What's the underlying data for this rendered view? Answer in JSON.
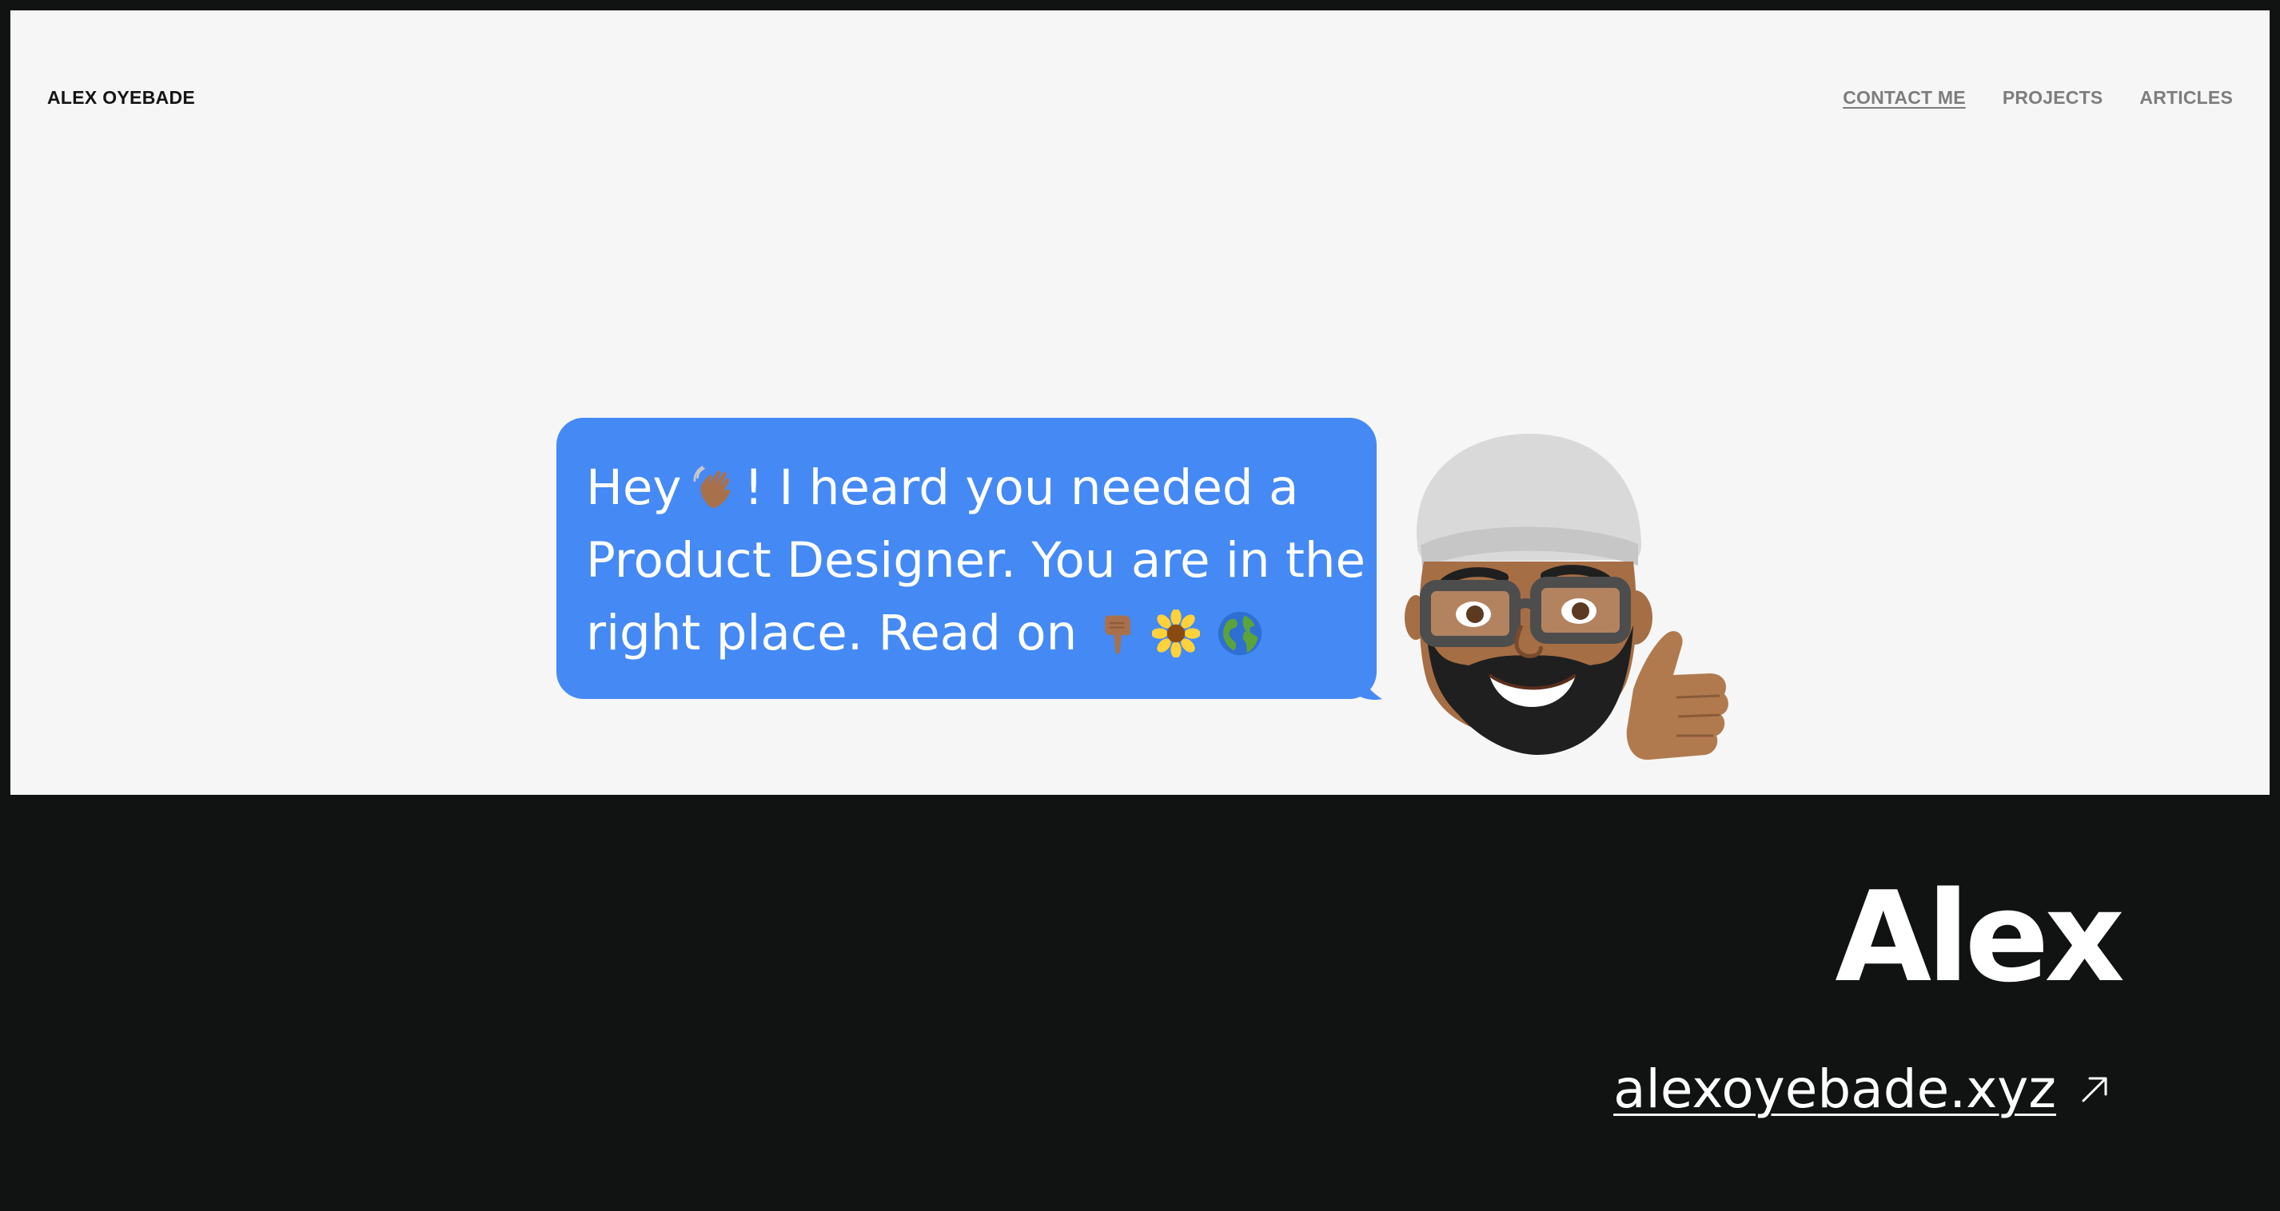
{
  "header": {
    "logo": "ALEX OYEBADE",
    "nav": [
      {
        "label": "CONTACT ME"
      },
      {
        "label": "PROJECTS"
      },
      {
        "label": "ARTICLES"
      }
    ]
  },
  "hero": {
    "message": {
      "line1_a": "Hey",
      "line1_b": "! I heard you needed a",
      "line2": "Product Designer. You are in the",
      "line3": "right place. Read on"
    },
    "emoji_icons": [
      "waving-hand-icon",
      "pointing-down-icon",
      "sunflower-icon",
      "globe-icon"
    ],
    "avatar_icon": "memoji-avatar"
  },
  "footer": {
    "name": "Alex",
    "link": "alexoyebade.xyz",
    "link_icon": "arrow-up-right-icon"
  },
  "colors": {
    "background": "#111212",
    "screen": "#f6f6f6",
    "bubble": "#4589f5",
    "nav_text": "#7d7d7d"
  }
}
